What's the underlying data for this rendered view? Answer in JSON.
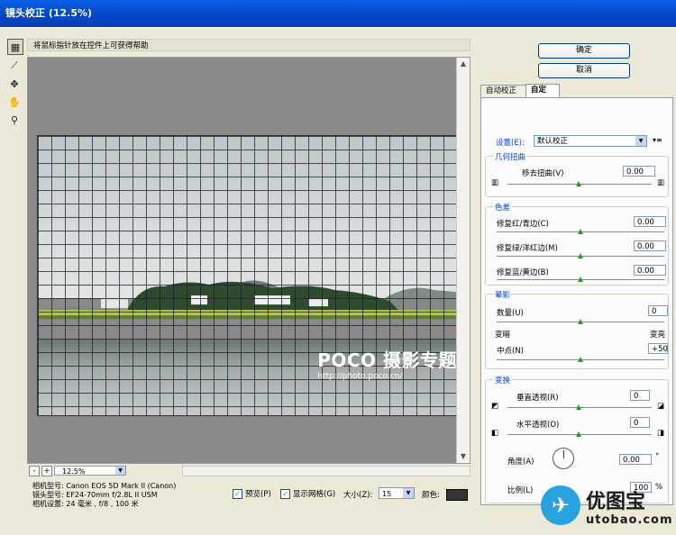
{
  "window": {
    "title": "镜头校正 (12.5%)"
  },
  "help_text": "将鼠标指针放在控件上可获得帮助",
  "watermark": {
    "main": "POCO 摄影专题",
    "url": "http://photo.poco.cn/"
  },
  "zoom": {
    "minus": "-",
    "plus": "+",
    "value": "12.5%"
  },
  "camera_info": {
    "model": "相机型号: Canon EOS 5D Mark II (Canon)",
    "lens": "镜头型号: EF24-70mm f/2.8L II USM",
    "settings": "相机设置: 24 毫米 , f/8 , 100 米"
  },
  "bottom": {
    "preview_label": "预览(P)",
    "show_grid_label": "显示网格(G)",
    "size_label": "大小(Z):",
    "size_value": "15",
    "color_label": "颜色:",
    "grid_color": "#333333"
  },
  "buttons": {
    "ok": "确定",
    "cancel": "取消"
  },
  "tabs": [
    {
      "label": "自动校正"
    },
    {
      "label": "自定"
    }
  ],
  "settings": {
    "label": "设置(E):",
    "value": "默认校正",
    "menu_icon": "▾≡"
  },
  "geometric": {
    "title": "几何扭曲",
    "remove_distortion_label": "移去扭曲(V)",
    "remove_distortion_value": "0.00"
  },
  "chromatic": {
    "title": "色差",
    "red_cyan_label": "修复红/青边(C)",
    "red_cyan_value": "0.00",
    "green_magenta_label": "修复绿/洋红边(M)",
    "green_magenta_value": "0.00",
    "blue_yellow_label": "修复蓝/黄边(B)",
    "blue_yellow_value": "0.00"
  },
  "vignette": {
    "title": "晕影",
    "amount_label": "数量(U)",
    "amount_value": "0",
    "dark": "变暗",
    "light": "变亮",
    "midpoint_label": "中点(N)",
    "midpoint_value": "+50"
  },
  "transform": {
    "title": "变换",
    "vertical_label": "垂直透视(R)",
    "vertical_value": "0",
    "horizontal_label": "水平透视(O)",
    "horizontal_value": "0",
    "angle_label": "角度(A)",
    "angle_value": "0.00",
    "angle_unit": "°",
    "scale_label": "比例(L)",
    "scale_value": "100",
    "scale_unit": "%"
  },
  "logo": {
    "cn": "优图宝",
    "en": "utobao.com"
  }
}
